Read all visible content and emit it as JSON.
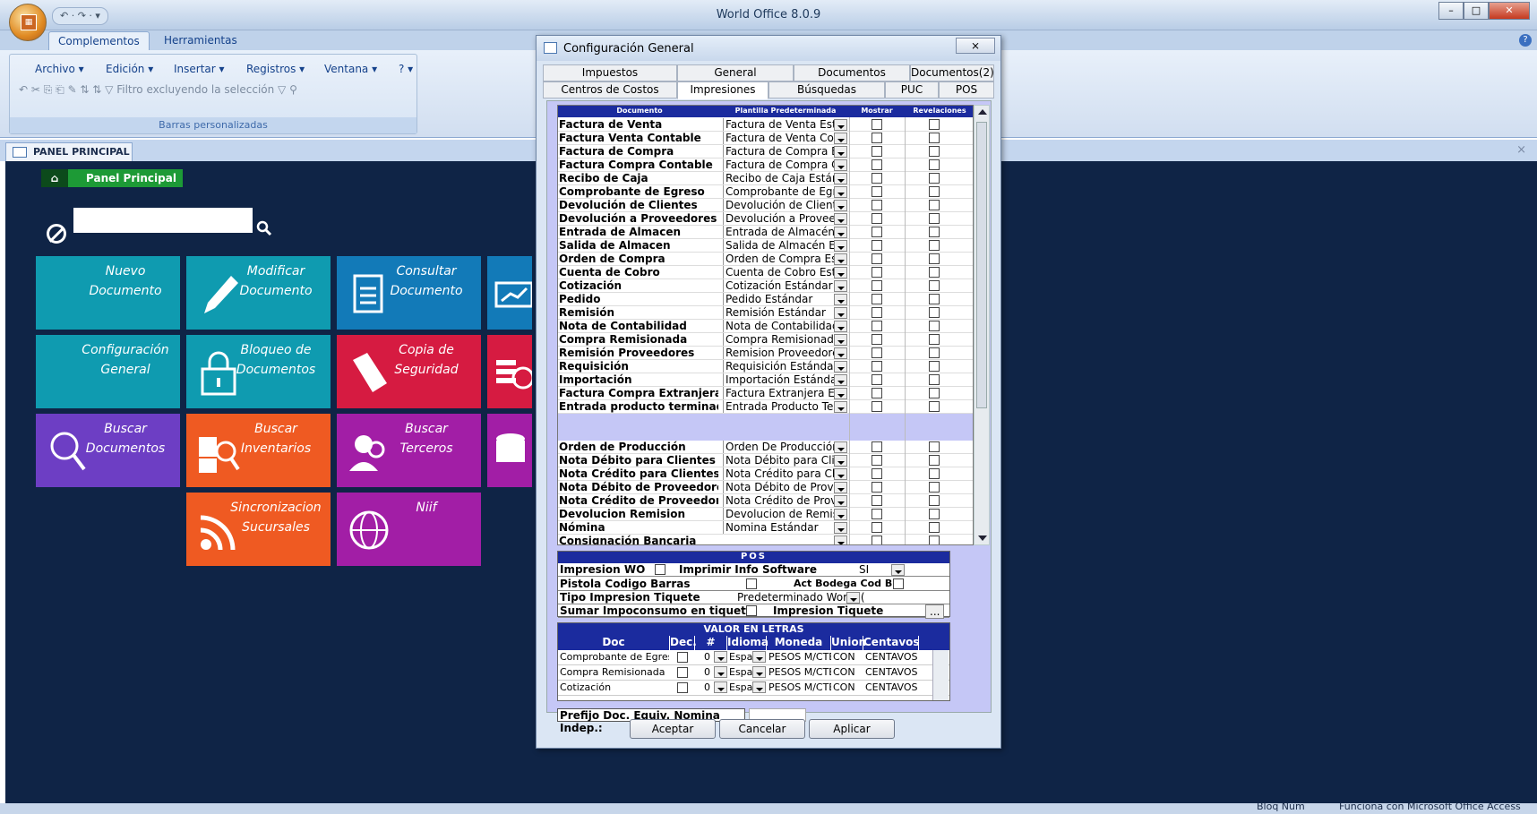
{
  "app": {
    "title": "World Office 8.0.9",
    "quick_access": "↶ · ↷ · ▾"
  },
  "ribbon": {
    "tabs": [
      "Complementos",
      "Herramientas"
    ],
    "menus": [
      "Archivo ▾",
      "Edición ▾",
      "Insertar ▾",
      "Registros ▾",
      "Ventana ▾",
      "? ▾"
    ],
    "tools_text": "↶ ✂ ⎘ ⎗ ✎ ⇅ ⇅ ▽ Filtro excluyendo la selección ▽ ⚲",
    "group_label": "Barras personalizadas"
  },
  "panel_tab": {
    "label": "PANEL PRINCIPAL",
    "close": "×"
  },
  "panel": {
    "home_label": "Panel Principal",
    "home_icon": "home-icon",
    "tiles": [
      {
        "label": "Nuevo Documento",
        "color": "#0f9bb0"
      },
      {
        "label": "Modificar Documento",
        "color": "#0f9bb0"
      },
      {
        "label": "Consultar Documento",
        "color": "#127ab8"
      },
      {
        "label": "Configuración General",
        "color": "#0f9bb0"
      },
      {
        "label": "Bloqueo de Documentos",
        "color": "#0f9bb0"
      },
      {
        "label": "Copia de Seguridad",
        "color": "#d61b41"
      },
      {
        "label": "Buscar Documentos",
        "color": "#6d3ec4"
      },
      {
        "label": "Buscar Inventarios",
        "color": "#ef5a22"
      },
      {
        "label": "Buscar Terceros",
        "color": "#a21ea6"
      },
      {
        "label": "Sincronizacion Sucursales",
        "color": "#ef5a22"
      },
      {
        "label": "Niif",
        "color": "#a21ea6"
      }
    ]
  },
  "status": {
    "num": "Bloq Num",
    "access": "Funciona con Microsoft Office Access"
  },
  "dialog": {
    "title": "Configuración General",
    "close": "⨯",
    "tabs_row1": [
      "Impuestos",
      "General",
      "Documentos",
      "Documentos(2)"
    ],
    "tabs_row2": [
      "Centros de Costos",
      "Impresiones",
      "Búsquedas",
      "PUC",
      "POS"
    ],
    "grid_headers": {
      "doc": "Documento",
      "plantilla": "Plantilla Predeterminada",
      "mostrar": "Mostrar",
      "revelaciones": "Revelaciones"
    },
    "rows": [
      {
        "doc": "Factura de Venta",
        "plantilla": "Factura de Venta Están"
      },
      {
        "doc": "Factura Venta Contable",
        "plantilla": "Factura de Venta Conta"
      },
      {
        "doc": "Factura de Compra",
        "plantilla": "Factura de Compra Est"
      },
      {
        "doc": "Factura Compra Contable",
        "plantilla": "Factura de Compra Cor"
      },
      {
        "doc": "Recibo de Caja",
        "plantilla": "Recibo de Caja Estánda"
      },
      {
        "doc": "Comprobante de Egreso",
        "plantilla": "Comprobante de Egres"
      },
      {
        "doc": "Devolución de Clientes",
        "plantilla": "Devolución de Clientes I"
      },
      {
        "doc": "Devolución a Proveedores",
        "plantilla": "Devolución a Proveedor"
      },
      {
        "doc": "Entrada de Almacen",
        "plantilla": "Entrada de Almacén Est"
      },
      {
        "doc": "Salida de Almacen",
        "plantilla": "Salida de Almacén Está"
      },
      {
        "doc": "Orden de Compra",
        "plantilla": "Orden de Compra Estár"
      },
      {
        "doc": "Cuenta de Cobro",
        "plantilla": "Cuenta de Cobro Están"
      },
      {
        "doc": "Cotización",
        "plantilla": "Cotización Estándar"
      },
      {
        "doc": "Pedido",
        "plantilla": "Pedido Estándar"
      },
      {
        "doc": "Remisión",
        "plantilla": "Remisión Estándar"
      },
      {
        "doc": "Nota de Contabilidad",
        "plantilla": "Nota de Contabilidad Es"
      },
      {
        "doc": "Compra Remisionada",
        "plantilla": "Compra Remisionada Es"
      },
      {
        "doc": "Remisión Proveedores",
        "plantilla": "Remision Proveedores E"
      },
      {
        "doc": "Requisición",
        "plantilla": "Requisición Estándar"
      },
      {
        "doc": "Importación",
        "plantilla": "Importación Estándar"
      },
      {
        "doc": "Factura Compra Extranjera",
        "plantilla": "Factura Extranjera Está"
      },
      {
        "doc": "Entrada producto terminado",
        "plantilla": "Entrada Producto Termi"
      },
      {
        "doc": "",
        "plantilla": ""
      },
      {
        "doc": "",
        "plantilla": ""
      },
      {
        "doc": "Orden de Producción",
        "plantilla": "Orden De Producción Es"
      },
      {
        "doc": "Nota Débito para Clientes",
        "plantilla": "Nota Débito para Client"
      },
      {
        "doc": "Nota Crédito para Clientes",
        "plantilla": "Nota Crédito para Clien"
      },
      {
        "doc": "Nota Débito de Proveedores",
        "plantilla": "Nota Débito de Proveec"
      },
      {
        "doc": "Nota Crédito de Proveedores",
        "plantilla": "Nota Crédito de Provee"
      },
      {
        "doc": "Devolucion Remision",
        "plantilla": "Devolucion de Remisión"
      },
      {
        "doc": "Nómina",
        "plantilla": "Nomina Estándar"
      },
      {
        "doc": "Consignación Bancaria",
        "plantilla": ""
      }
    ],
    "pos": {
      "title": "POS",
      "impresion_wo": "Impresion WO",
      "imprimir_info": "Imprimir Info Software",
      "imprimir_val": "SI",
      "pistola": "Pistola Codigo Barras",
      "act_bodega": "Act Bodega Cod B",
      "tipo_impresion": "Tipo Impresion Tiquete",
      "tipo_val": "Predeterminado World (",
      "sumar": "Sumar Impoconsumo en tiquete",
      "impresion_tiquete": "Impresion Tiquete",
      "dots": "..."
    },
    "valor": {
      "title": "VALOR EN LETRAS",
      "cols": [
        "Doc",
        "Dec.",
        "# Dec",
        "Idioma",
        "Moneda",
        "Union",
        "Centavos"
      ],
      "rows": [
        {
          "doc": "Comprobante de Egresc",
          "ndec": "0",
          "idioma": "Espa",
          "moneda": "PESOS M/CTE",
          "union": "CON",
          "centavos": "CENTAVOS"
        },
        {
          "doc": "Compra Remisionada",
          "ndec": "0",
          "idioma": "Espa",
          "moneda": "PESOS M/CTE",
          "union": "CON",
          "centavos": "CENTAVOS"
        },
        {
          "doc": "Cotización",
          "ndec": "0",
          "idioma": "Espa",
          "moneda": "PESOS M/CTE",
          "union": "CON",
          "centavos": "CENTAVOS"
        }
      ]
    },
    "prefijo": "Prefijo  Doc. Equiv. Nomina Indep.:",
    "buttons": {
      "aceptar": "Aceptar",
      "cancelar": "Cancelar",
      "aplicar": "Aplicar"
    }
  }
}
